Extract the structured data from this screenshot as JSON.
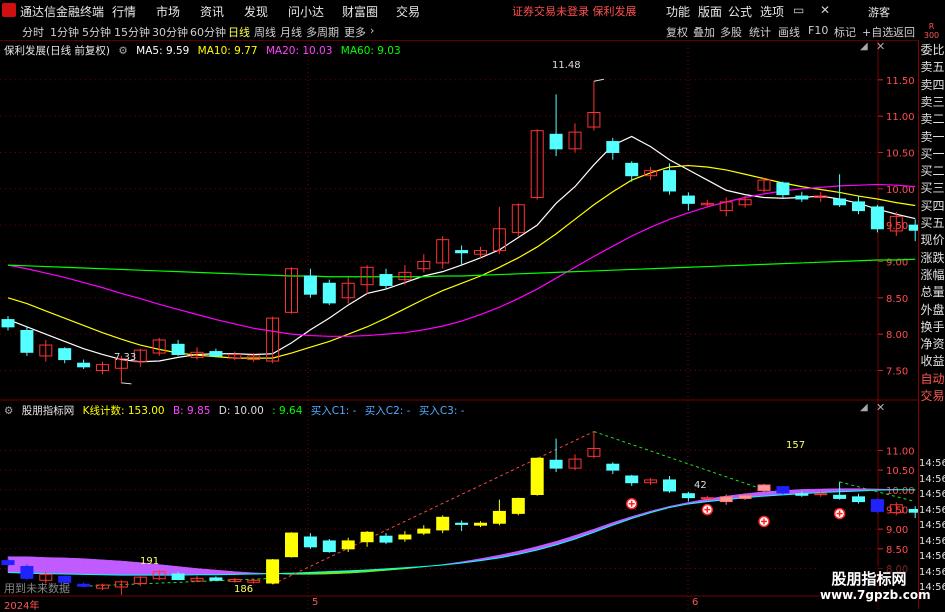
{
  "app": {
    "title": "通达信金融终端",
    "menu": [
      "行情",
      "市场",
      "资讯",
      "发现",
      "问小达",
      "财富圈",
      "交易"
    ],
    "notice": "证券交易未登录  保利发展",
    "right_menu": [
      "功能",
      "版面",
      "公式",
      "选项"
    ],
    "guest": "游客"
  },
  "toolbar": {
    "periods": [
      "分时",
      "1分钟",
      "5分钟",
      "15分钟",
      "30分钟",
      "60分钟",
      "日线",
      "周线",
      "月线",
      "多周期",
      "更多"
    ],
    "active_period": "日线",
    "right_buttons": [
      "复权",
      "叠加",
      "多股",
      "统计",
      "画线",
      "F10",
      "标记",
      "+自选",
      "返回"
    ]
  },
  "colors": {
    "up": "#ff3232",
    "down": "#54ffff",
    "ma5": "#ffffff",
    "ma10": "#ffff00",
    "ma20": "#ff00ff",
    "ma60": "#00ff00",
    "grid": "#7a0000",
    "accent": "#ff4d4d"
  },
  "main_chart": {
    "stock_label": "保利发展(日线 前复权)",
    "ma": [
      {
        "label": "MA5: 9.59",
        "color": "#ffffff"
      },
      {
        "label": "MA10: 9.77",
        "color": "#ffff00"
      },
      {
        "label": "MA20: 10.03",
        "color": "#ff44ff"
      },
      {
        "label": "MA60: 9.03",
        "color": "#00ff00"
      }
    ],
    "high_label": "11.48",
    "low_label": "7.33"
  },
  "sub_chart": {
    "name": "股朋指标网",
    "fields": [
      {
        "label": "K线计数: 153.00",
        "color": "#ffff00"
      },
      {
        "label": "B: 9.85",
        "color": "#ff44ff"
      },
      {
        "label": "D: 10.00",
        "color": "#dddddd"
      },
      {
        "label": ": 9.64",
        "color": "#00ff00"
      },
      {
        "label": "买入C1: -",
        "color": "#55aaff"
      },
      {
        "label": "买入C2: -",
        "color": "#55aaff"
      },
      {
        "label": "买入C3: -",
        "color": "#55aaff"
      }
    ],
    "count_labels": [
      "157",
      "191",
      "186",
      "42"
    ],
    "future_text": "用到未来数据"
  },
  "xaxis": {
    "labels": [
      "2024年",
      "5",
      "6"
    ]
  },
  "sidebar": {
    "header": [
      "R",
      "300"
    ],
    "items": [
      "委比",
      "卖五",
      "卖四",
      "卖三",
      "卖二",
      "卖一",
      "买一",
      "买二",
      "买三",
      "买四",
      "买五",
      "现价",
      "涨跌",
      "涨幅",
      "总量",
      "外盘",
      "换手",
      "净资",
      "收益",
      "自动",
      "交易"
    ],
    "times": [
      "14:56",
      "14:56",
      "14:56",
      "14:56",
      "14:56",
      "14:56",
      "14:56",
      "14:56",
      "14:56"
    ]
  },
  "watermark": {
    "line1": "股朋指标网",
    "line2": "www.7gpzb.com"
  },
  "chart_data": {
    "type": "candlestick",
    "title": "保利发展(日线 前复权)",
    "xlabel": "",
    "ylabel": "",
    "ylim": [
      7.3,
      11.8
    ],
    "yticks": [
      7.5,
      8.0,
      8.5,
      9.0,
      9.5,
      10.0,
      10.5,
      11.0,
      11.5
    ],
    "sub_yticks": [
      8.0,
      8.5,
      9.0,
      9.5,
      10.0,
      10.5,
      11.0
    ],
    "sub_ylim": [
      7.25,
      11.9
    ],
    "candles": [
      {
        "o": 8.2,
        "c": 8.1,
        "h": 8.25,
        "l": 8.05
      },
      {
        "o": 8.05,
        "c": 7.75,
        "h": 8.1,
        "l": 7.7
      },
      {
        "o": 7.7,
        "c": 7.85,
        "h": 7.92,
        "l": 7.62
      },
      {
        "o": 7.8,
        "c": 7.65,
        "h": 7.82,
        "l": 7.6
      },
      {
        "o": 7.6,
        "c": 7.55,
        "h": 7.65,
        "l": 7.52
      },
      {
        "o": 7.5,
        "c": 7.58,
        "h": 7.62,
        "l": 7.45
      },
      {
        "o": 7.53,
        "c": 7.66,
        "h": 7.7,
        "l": 7.33
      },
      {
        "o": 7.62,
        "c": 7.78,
        "h": 7.8,
        "l": 7.55
      },
      {
        "o": 7.74,
        "c": 7.92,
        "h": 7.95,
        "l": 7.7
      },
      {
        "o": 7.86,
        "c": 7.72,
        "h": 7.92,
        "l": 7.7
      },
      {
        "o": 7.68,
        "c": 7.75,
        "h": 7.82,
        "l": 7.65
      },
      {
        "o": 7.76,
        "c": 7.7,
        "h": 7.8,
        "l": 7.68
      },
      {
        "o": 7.67,
        "c": 7.72,
        "h": 7.76,
        "l": 7.64
      },
      {
        "o": 7.65,
        "c": 7.7,
        "h": 7.74,
        "l": 7.62
      },
      {
        "o": 7.63,
        "c": 8.22,
        "h": 8.24,
        "l": 7.6
      },
      {
        "o": 8.3,
        "c": 8.9,
        "h": 8.92,
        "l": 8.28
      },
      {
        "o": 8.8,
        "c": 8.55,
        "h": 8.9,
        "l": 8.5
      },
      {
        "o": 8.7,
        "c": 8.43,
        "h": 8.75,
        "l": 8.4
      },
      {
        "o": 8.5,
        "c": 8.7,
        "h": 8.78,
        "l": 8.42
      },
      {
        "o": 8.68,
        "c": 8.92,
        "h": 8.95,
        "l": 8.55
      },
      {
        "o": 8.82,
        "c": 8.67,
        "h": 8.9,
        "l": 8.62
      },
      {
        "o": 8.75,
        "c": 8.85,
        "h": 8.95,
        "l": 8.68
      },
      {
        "o": 8.9,
        "c": 9.0,
        "h": 9.1,
        "l": 8.85
      },
      {
        "o": 8.98,
        "c": 9.3,
        "h": 9.35,
        "l": 8.9
      },
      {
        "o": 9.15,
        "c": 9.12,
        "h": 9.22,
        "l": 8.95
      },
      {
        "o": 9.1,
        "c": 9.15,
        "h": 9.2,
        "l": 9.05
      },
      {
        "o": 9.15,
        "c": 9.45,
        "h": 9.75,
        "l": 9.1
      },
      {
        "o": 9.4,
        "c": 9.78,
        "h": 9.8,
        "l": 9.35
      },
      {
        "o": 9.88,
        "c": 10.8,
        "h": 10.82,
        "l": 9.85
      },
      {
        "o": 10.75,
        "c": 10.55,
        "h": 11.3,
        "l": 10.45
      },
      {
        "o": 10.55,
        "c": 10.78,
        "h": 10.9,
        "l": 10.5
      },
      {
        "o": 10.85,
        "c": 11.05,
        "h": 11.48,
        "l": 10.8
      },
      {
        "o": 10.65,
        "c": 10.5,
        "h": 10.7,
        "l": 10.4
      },
      {
        "o": 10.35,
        "c": 10.18,
        "h": 10.38,
        "l": 10.1
      },
      {
        "o": 10.18,
        "c": 10.25,
        "h": 10.3,
        "l": 10.12
      },
      {
        "o": 10.25,
        "c": 9.97,
        "h": 10.35,
        "l": 9.92
      },
      {
        "o": 9.9,
        "c": 9.8,
        "h": 9.95,
        "l": 9.7
      },
      {
        "o": 9.78,
        "c": 9.8,
        "h": 9.85,
        "l": 9.75
      },
      {
        "o": 9.7,
        "c": 9.82,
        "h": 9.88,
        "l": 9.62
      },
      {
        "o": 9.78,
        "c": 9.85,
        "h": 9.9,
        "l": 9.74
      },
      {
        "o": 9.98,
        "c": 10.12,
        "h": 10.15,
        "l": 9.95
      },
      {
        "o": 10.08,
        "c": 9.92,
        "h": 10.1,
        "l": 9.88
      },
      {
        "o": 9.9,
        "c": 9.86,
        "h": 9.96,
        "l": 9.82
      },
      {
        "o": 9.88,
        "c": 9.9,
        "h": 9.96,
        "l": 9.82
      },
      {
        "o": 9.86,
        "c": 9.78,
        "h": 10.2,
        "l": 9.75
      },
      {
        "o": 9.82,
        "c": 9.7,
        "h": 9.9,
        "l": 9.65
      },
      {
        "o": 9.75,
        "c": 9.45,
        "h": 9.78,
        "l": 9.4
      },
      {
        "o": 9.42,
        "c": 9.62,
        "h": 9.68,
        "l": 9.35
      },
      {
        "o": 9.5,
        "c": 9.43,
        "h": 9.58,
        "l": 9.28
      }
    ],
    "series": [
      {
        "name": "MA5",
        "color": "#ffffff",
        "values": [
          8.2,
          8.1,
          8.0,
          7.9,
          7.8,
          7.72,
          7.65,
          7.62,
          7.63,
          7.68,
          7.72,
          7.73,
          7.73,
          7.72,
          7.73,
          7.88,
          8.06,
          8.22,
          8.4,
          8.56,
          8.62,
          8.71,
          8.8,
          8.86,
          8.95,
          9.05,
          9.16,
          9.33,
          9.5,
          9.8,
          10.03,
          10.33,
          10.6,
          10.72,
          10.58,
          10.4,
          10.26,
          10.12,
          9.98,
          9.92,
          9.88,
          9.87,
          9.88,
          9.9,
          9.86,
          9.8,
          9.72,
          9.65,
          9.59
        ]
      },
      {
        "name": "MA10",
        "color": "#ffff00",
        "values": [
          8.5,
          8.42,
          8.32,
          8.22,
          8.12,
          8.02,
          7.93,
          7.85,
          7.79,
          7.74,
          7.71,
          7.69,
          7.67,
          7.67,
          7.67,
          7.74,
          7.82,
          7.9,
          8.0,
          8.1,
          8.22,
          8.35,
          8.48,
          8.6,
          8.7,
          8.8,
          8.92,
          9.05,
          9.2,
          9.38,
          9.58,
          9.78,
          9.96,
          10.12,
          10.22,
          10.3,
          10.32,
          10.3,
          10.26,
          10.2,
          10.14,
          10.08,
          10.03,
          9.99,
          9.95,
          9.9,
          9.86,
          9.81,
          9.77
        ]
      },
      {
        "name": "MA20",
        "color": "#ff00ff",
        "values": [
          8.95,
          8.9,
          8.84,
          8.78,
          8.71,
          8.64,
          8.56,
          8.49,
          8.41,
          8.34,
          8.27,
          8.2,
          8.14,
          8.08,
          8.04,
          8.0,
          7.98,
          7.97,
          7.97,
          7.98,
          8.0,
          8.02,
          8.06,
          8.11,
          8.18,
          8.27,
          8.37,
          8.49,
          8.62,
          8.77,
          8.92,
          9.07,
          9.21,
          9.35,
          9.47,
          9.58,
          9.67,
          9.75,
          9.82,
          9.88,
          9.93,
          9.97,
          10.0,
          10.02,
          10.04,
          10.05,
          10.06,
          10.05,
          10.03
        ]
      },
      {
        "name": "MA60",
        "color": "#00ff00",
        "values": [
          8.95,
          8.94,
          8.93,
          8.92,
          8.91,
          8.9,
          8.89,
          8.88,
          8.87,
          8.86,
          8.85,
          8.84,
          8.83,
          8.82,
          8.81,
          8.8,
          8.8,
          8.79,
          8.79,
          8.79,
          8.79,
          8.79,
          8.79,
          8.8,
          8.8,
          8.81,
          8.82,
          8.83,
          8.84,
          8.85,
          8.86,
          8.87,
          8.88,
          8.89,
          8.9,
          8.91,
          8.92,
          8.93,
          8.94,
          8.95,
          8.96,
          8.97,
          8.98,
          8.99,
          9.0,
          9.01,
          9.02,
          9.02,
          9.03
        ]
      }
    ],
    "band_lines": [
      {
        "name": "B",
        "color": "#cc55ff",
        "values": [
          8.3,
          8.3,
          8.28,
          8.27,
          8.25,
          8.22,
          8.19,
          8.15,
          8.1,
          8.05,
          8.0,
          7.96,
          7.92,
          7.89,
          7.87,
          7.85,
          7.85,
          7.86,
          7.88,
          7.91,
          7.95,
          7.99,
          8.04,
          8.1,
          8.17,
          8.25,
          8.34,
          8.44,
          8.56,
          8.69,
          8.84,
          9.0,
          9.17,
          9.32,
          9.46,
          9.58,
          9.68,
          9.77,
          9.84,
          9.9,
          9.95,
          9.98,
          10.01,
          10.02,
          10.03,
          10.03,
          10.02,
          10.01,
          9.99
        ]
      },
      {
        "name": "D",
        "color": "#00ffff",
        "values": [
          7.9,
          7.88,
          7.87,
          7.86,
          7.85,
          7.84,
          7.83,
          7.83,
          7.83,
          7.83,
          7.84,
          7.84,
          7.85,
          7.86,
          7.87,
          7.88,
          7.9,
          7.92,
          7.94,
          7.96,
          7.99,
          8.02,
          8.05,
          8.09,
          8.14,
          8.2,
          8.27,
          8.36,
          8.47,
          8.6,
          8.75,
          8.92,
          9.1,
          9.27,
          9.42,
          9.55,
          9.64,
          9.7,
          9.75,
          9.8,
          9.84,
          9.87,
          9.9,
          9.93,
          9.95,
          9.97,
          9.99,
          10.0,
          10.0
        ]
      }
    ]
  }
}
